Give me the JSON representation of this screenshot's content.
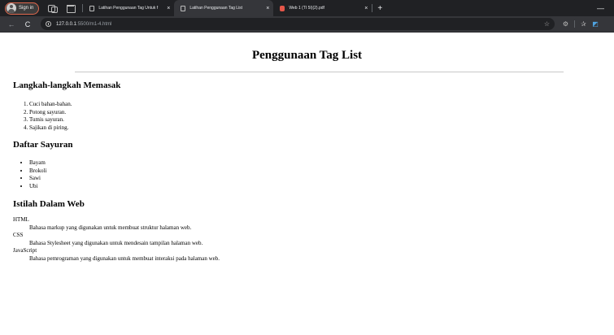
{
  "browser": {
    "signin_label": "Sign in",
    "tabs": [
      {
        "title": "Latihan Penggunaan Tag Untuk f",
        "active": false,
        "favicon": "page-icon"
      },
      {
        "title": "Latihan Penggunaan Tag List",
        "active": true,
        "favicon": "page-icon"
      },
      {
        "title": "Web 1 (TI 5I)(2).pdf",
        "active": false,
        "favicon": "pdf-icon"
      }
    ],
    "tab_close_glyph": "×",
    "new_tab_glyph": "+",
    "minimize_glyph": "—",
    "back_glyph": "←",
    "reload_glyph": "C",
    "url_host": "127.0.0.1",
    "url_path": ":5500/m1-4.html",
    "star_glyph": "☆",
    "extensions_glyph": "⚙",
    "favorites_glyph": "✰",
    "copilot_glyph": "◩"
  },
  "page": {
    "title": "Penggunaan Tag List",
    "sections": [
      {
        "heading": "Langkah-langkah Memasak",
        "items": [
          "Cuci bahan-bahan.",
          "Potong sayuran.",
          "Tumis sayuran.",
          "Sajikan di piring."
        ]
      },
      {
        "heading": "Daftar Sayuran",
        "items": [
          "Bayam",
          "Brokoli",
          "Sawi",
          "Ubi"
        ]
      },
      {
        "heading": "Istilah Dalam Web",
        "terms": [
          {
            "term": "HTML",
            "definition": "Bahasa markup yang digunakan untuk membuat struktur halaman web."
          },
          {
            "term": "CSS",
            "definition": "Bahasa Stylesheet yang digunakan untuk mendesain tampilan halaman web."
          },
          {
            "term": "JavaScript",
            "definition": "Bahasa pemrograman yang digunakan untuk membuat interaksi pada halaman web."
          }
        ]
      }
    ]
  }
}
